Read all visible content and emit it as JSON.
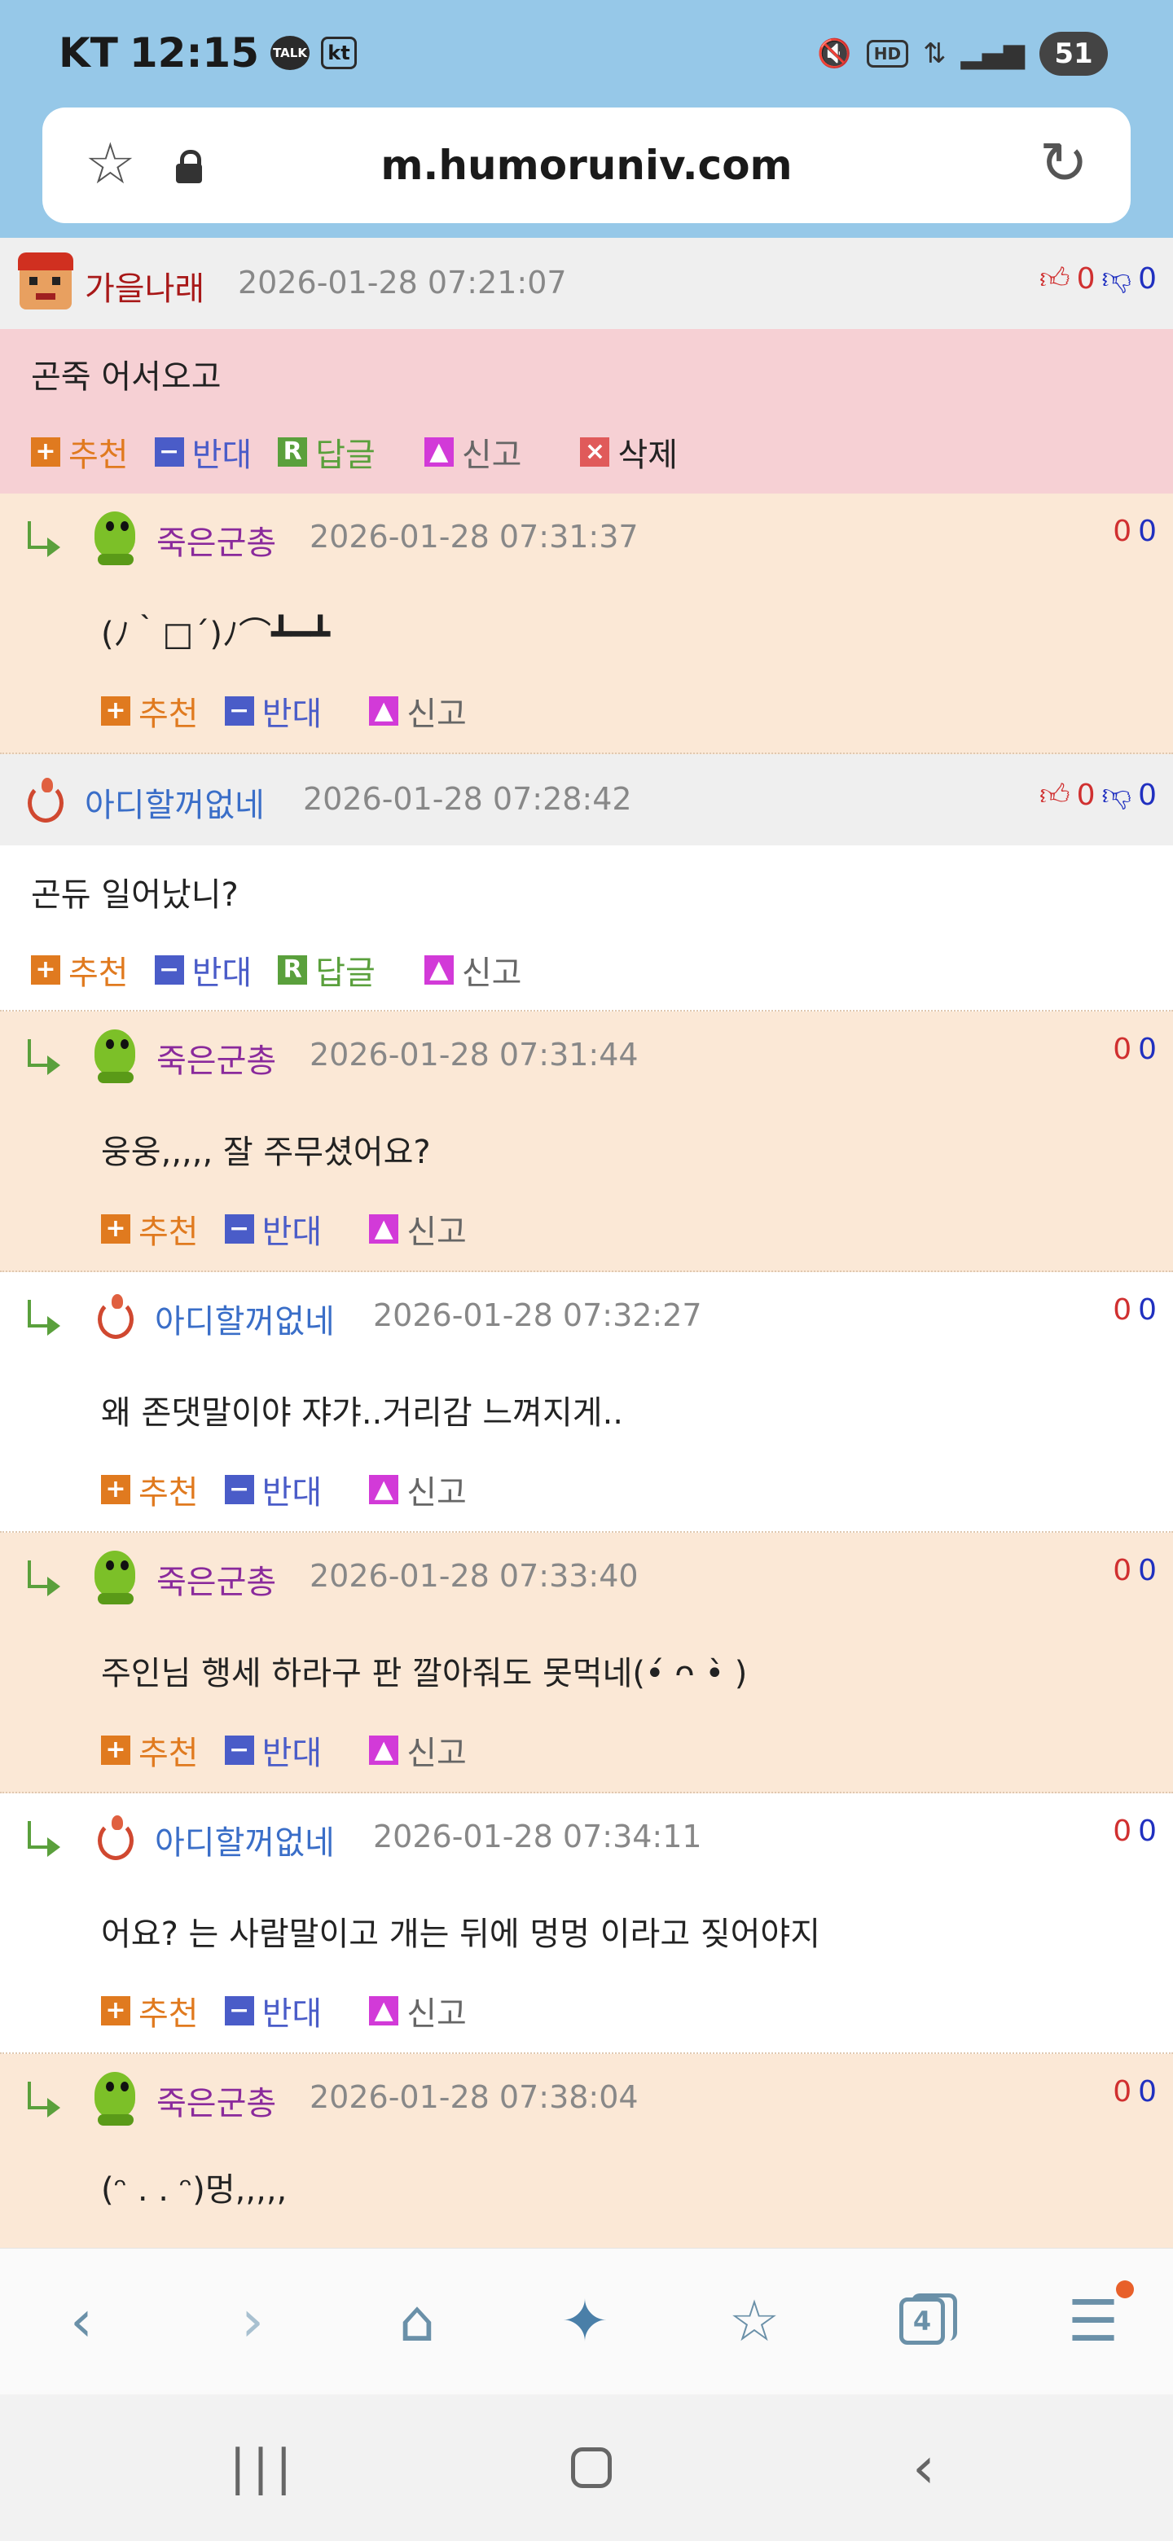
{
  "status_bar": {
    "carrier": "KT",
    "time": "12:15",
    "talk_badge": "TALK",
    "kt_badge": "kt",
    "hd": "HD",
    "battery": "51"
  },
  "browser": {
    "url": "m.humoruniv.com"
  },
  "comments": [
    {
      "user": "가을나래",
      "date": "2026-01-28 07:21:07",
      "up": "0",
      "down": "0",
      "text": "곤죽 어서오고",
      "actions": {
        "recommend": "추천",
        "oppose": "반대",
        "reply": "답글",
        "report": "신고",
        "delete": "삭제"
      },
      "replies": [
        {
          "user": "죽은군총",
          "date": "2026-01-28 07:31:37",
          "up": "0",
          "down": "0",
          "text": "(ﾉ｀□´)ﾉ⌒┻━┻"
        }
      ]
    },
    {
      "user": "아디할꺼없네",
      "date": "2026-01-28 07:28:42",
      "up": "0",
      "down": "0",
      "text": "곤듀 일어났니?",
      "actions": {
        "recommend": "추천",
        "oppose": "반대",
        "reply": "답글",
        "report": "신고"
      },
      "replies": [
        {
          "user": "죽은군총",
          "date": "2026-01-28 07:31:44",
          "up": "0",
          "down": "0",
          "text": "웅웅,,,,, 잘 주무셨어요?"
        },
        {
          "user": "아디할꺼없네",
          "date": "2026-01-28 07:32:27",
          "up": "0",
          "down": "0",
          "text": "왜 존댓말이야 쟈갸..거리감 느껴지게.."
        },
        {
          "user": "죽은군총",
          "date": "2026-01-28 07:33:40",
          "up": "0",
          "down": "0",
          "text": "주인님 행세 하라구 판 깔아줘도 못먹네(•́ ᴖ •̀ )"
        },
        {
          "user": "아디할꺼없네",
          "date": "2026-01-28 07:34:11",
          "up": "0",
          "down": "0",
          "text": "어요? 는 사람말이고 개는 뒤에 멍멍 이라고 짖어야지"
        },
        {
          "user": "죽은군총",
          "date": "2026-01-28 07:38:04",
          "up": "0",
          "down": "0",
          "text": "(ᵔ . . ᵔ)멍,,,,,"
        }
      ]
    }
  ],
  "reply_actions": {
    "recommend": "추천",
    "oppose": "반대",
    "report": "신고"
  },
  "toolbar": {
    "tabs_count": "4"
  },
  "colors": {
    "status_bg": "#96c8e8",
    "peach_bg": "#fbe8d6",
    "pink_bg": "#f6d0d4",
    "header_gray": "#efefef",
    "user_purple": "#8a2a9c",
    "user_blue": "#3a6ec8",
    "user_red": "#a81818"
  }
}
